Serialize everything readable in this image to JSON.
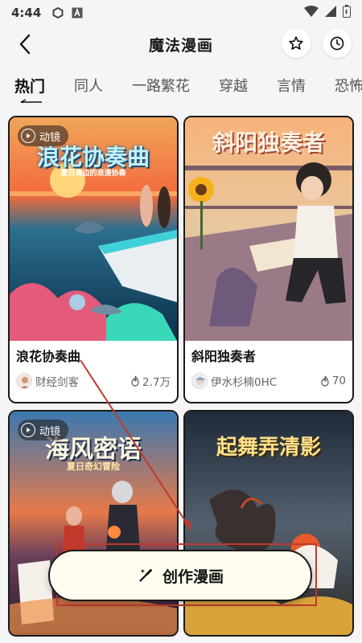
{
  "status_bar": {
    "time": "4:44"
  },
  "header": {
    "title": "魔法漫画"
  },
  "tabs": [
    {
      "label": "热门"
    },
    {
      "label": "同人"
    },
    {
      "label": "一路繁花"
    },
    {
      "label": "穿越"
    },
    {
      "label": "言情"
    },
    {
      "label": "恐怖"
    }
  ],
  "cards": [
    {
      "title": "浪花协奏曲",
      "art_title": "浪花协奏曲",
      "art_subtitle": "夏日海边的浪漫协奏",
      "author": "财经剑客",
      "hot": "2.7万",
      "badge": "动镜"
    },
    {
      "title": "斜阳独奏者",
      "art_title": "斜阳独奏者",
      "author": "伊水杉楠0HC",
      "hot": "70"
    },
    {
      "title": "",
      "art_title": "海风密语",
      "art_subtitle": "夏日奇幻冒险",
      "badge": "动镜"
    },
    {
      "title": "",
      "art_title": "起舞弄清影"
    }
  ],
  "create_button": {
    "label": "创作漫画"
  },
  "colors": {
    "annotation": "#c0392b",
    "accent_dark": "#1a1a1a"
  }
}
